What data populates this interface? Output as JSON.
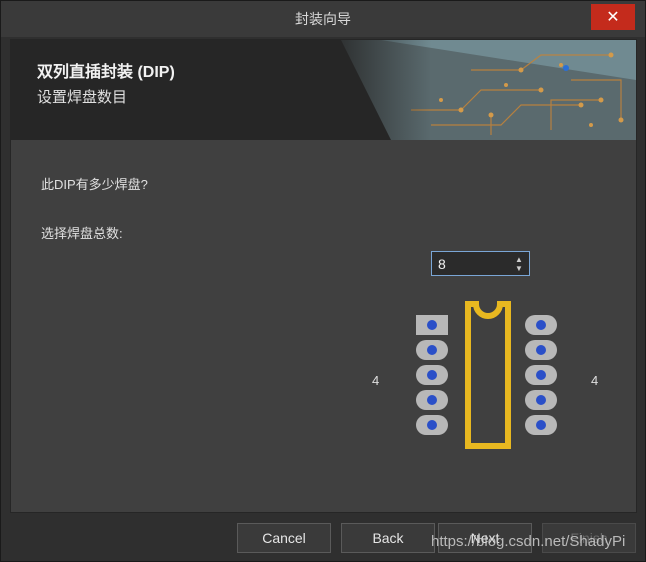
{
  "window": {
    "title": "封装向导",
    "close_glyph": "✕"
  },
  "banner": {
    "title": "双列直插封装 (DIP)",
    "subtitle": "设置焊盘数目"
  },
  "form": {
    "question": "此DIP有多少焊盘?",
    "select_label": "选择焊盘总数:",
    "pad_count": "8",
    "left_count": "4",
    "right_count": "4"
  },
  "footer": {
    "cancel_label": "Cancel",
    "back_label": "Back",
    "next_label": "Next",
    "finish_label": "Finish"
  },
  "watermark": "https://blog.csdn.net/ShadyPi",
  "colors": {
    "accent": "#7aa6d6",
    "close": "#c42b1c",
    "outline": "#e8b820",
    "pad": "#b8b8b8",
    "hole": "#2a4fc8"
  }
}
